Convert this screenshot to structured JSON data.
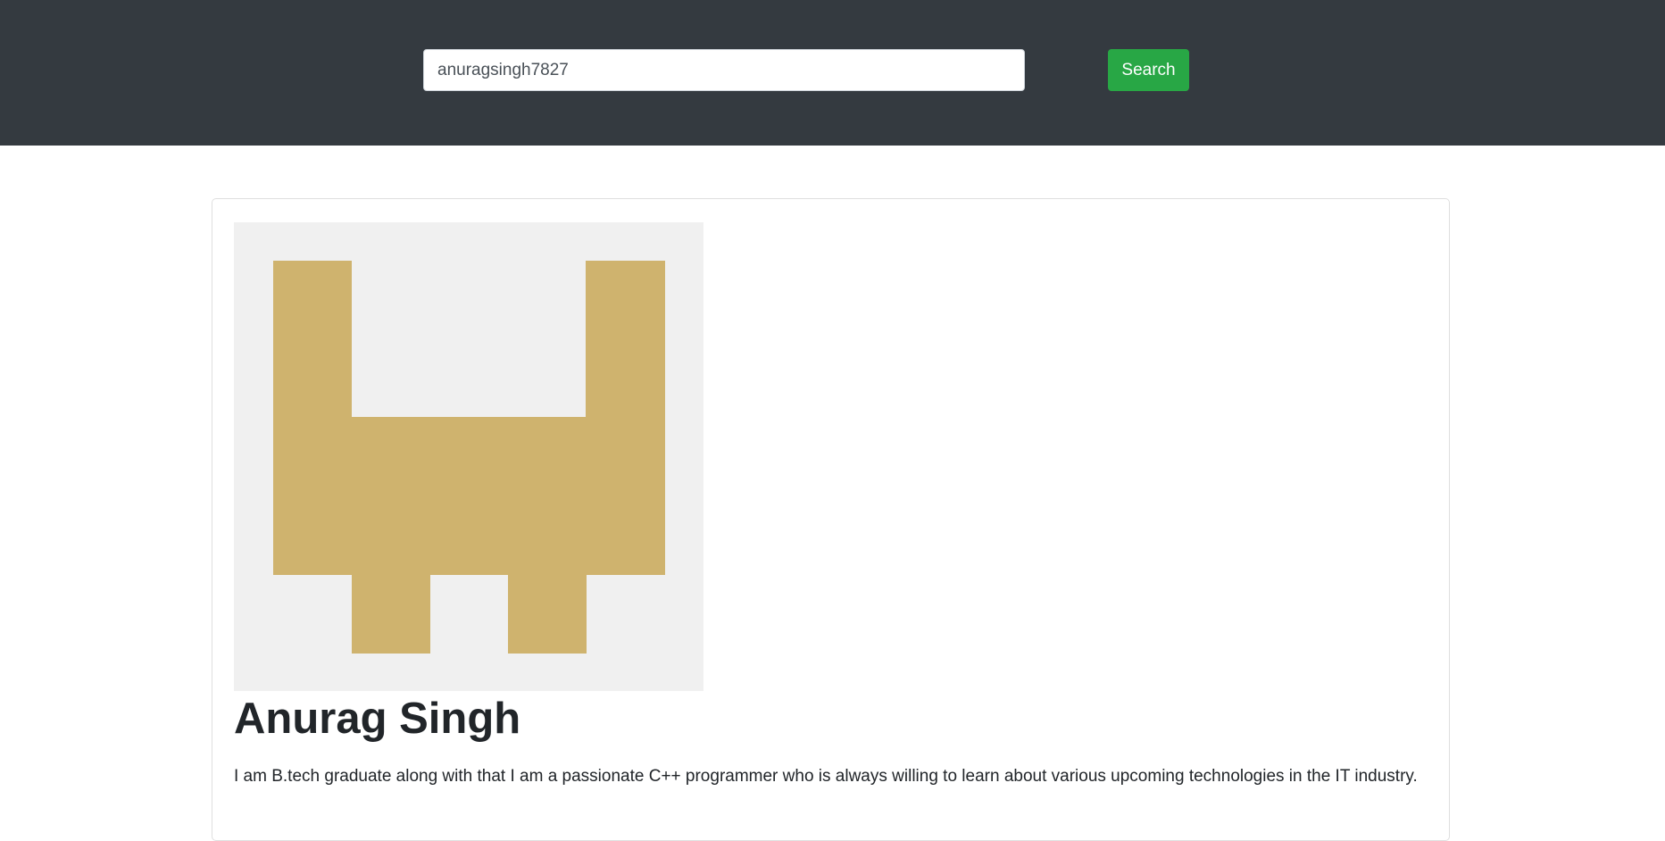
{
  "header": {
    "search": {
      "value": "anuragsingh7827",
      "button_label": "Search"
    }
  },
  "profile": {
    "avatar": {
      "background_color": "#f0f0f0",
      "pattern_color": "#cfb36e",
      "description": "identicon"
    },
    "name": "Anurag Singh",
    "bio": "I am B.tech graduate along with that I am a passionate C++ programmer who is always willing to learn about various upcoming technologies in the IT industry."
  },
  "colors": {
    "navbar": "#343a40",
    "search_button": "#28a745"
  }
}
